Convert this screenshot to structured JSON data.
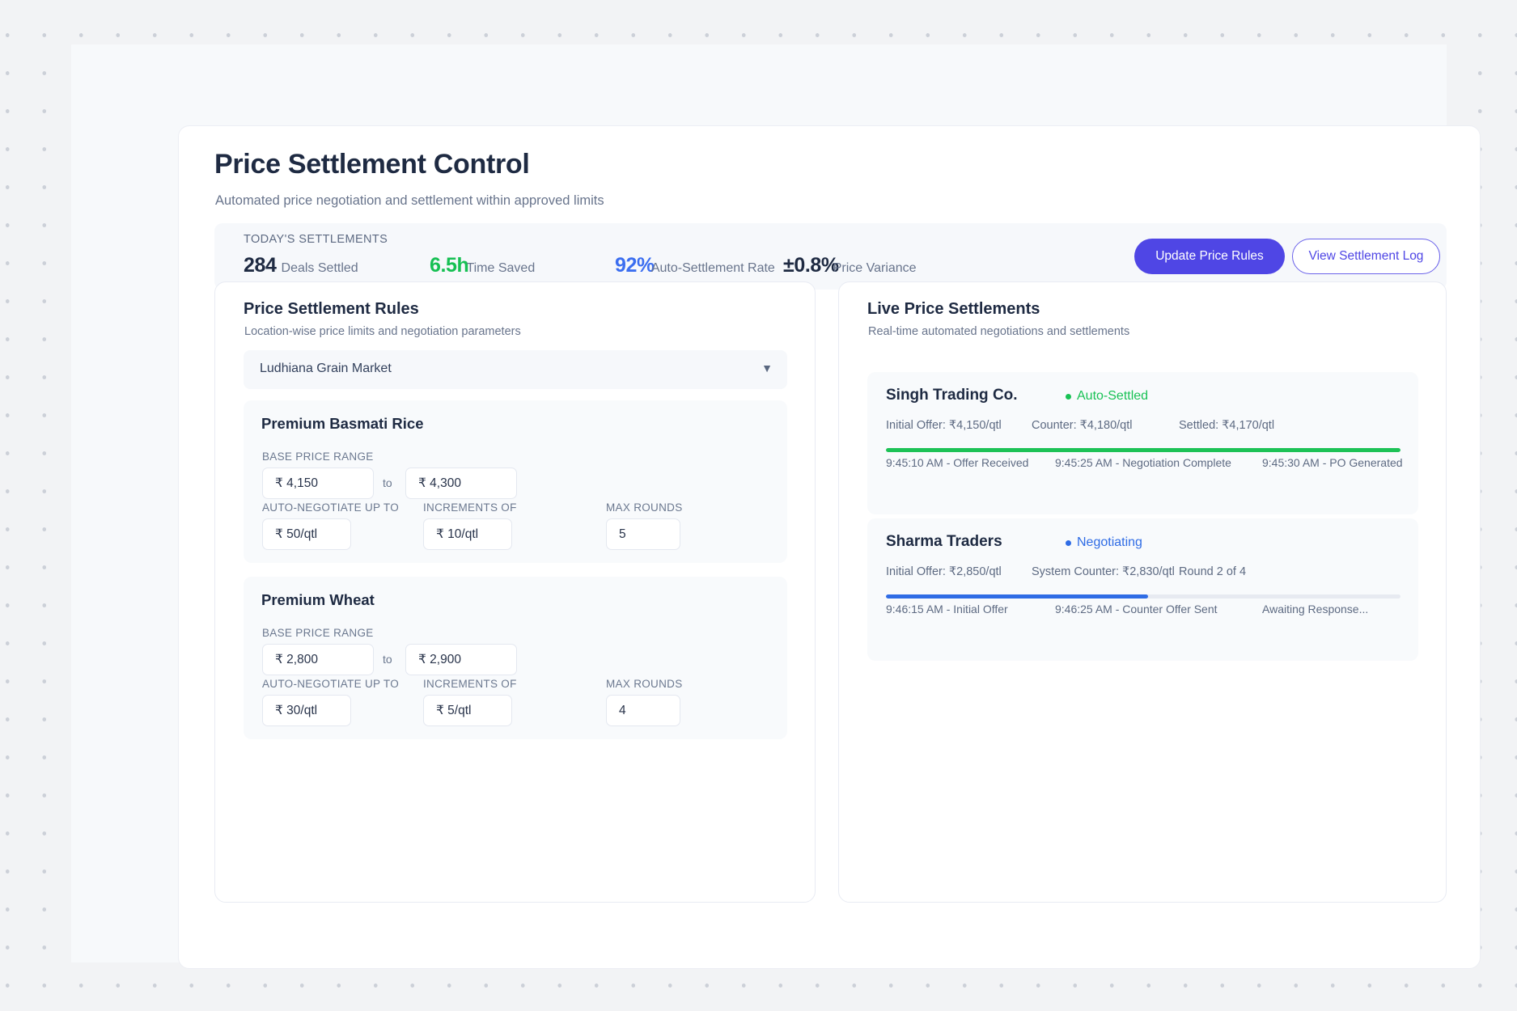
{
  "header": {
    "title": "Price Settlement Control",
    "subtitle": "Automated price negotiation and settlement within approved limits"
  },
  "stats": {
    "eyebrow": "TODAY'S SETTLEMENTS",
    "items": [
      {
        "value": "284",
        "label": "Deals Settled",
        "color": "#1e2a42"
      },
      {
        "value": "6.5h",
        "label": "Time Saved",
        "color": "#16c053"
      },
      {
        "value": "92%",
        "label": "Auto-Settlement Rate",
        "color": "#3b6ef0"
      },
      {
        "value": "±0.8%",
        "label": "Price Variance",
        "color": "#1e2a42"
      }
    ],
    "primary_button": "Update Price Rules",
    "outline_button": "View Settlement Log"
  },
  "rules_panel": {
    "title": "Price Settlement Rules",
    "subtitle": "Location-wise price limits and negotiation parameters",
    "location_select": {
      "value": "Ludhiana Grain Market",
      "caret": "▼"
    },
    "labels": {
      "base_price_range": "BASE PRICE RANGE",
      "auto_negotiate": "AUTO-NEGOTIATE UP TO",
      "increments": "INCREMENTS OF",
      "max_rounds": "MAX ROUNDS",
      "to": "to"
    },
    "commodities": [
      {
        "name": "Premium Basmati Rice",
        "min_price": "₹ 4,150",
        "max_price": "₹ 4,300",
        "auto_negotiate": "₹ 50/qtl",
        "increment": "₹ 10/qtl",
        "max_rounds": "5"
      },
      {
        "name": "Premium Wheat",
        "min_price": "₹ 2,800",
        "max_price": "₹ 2,900",
        "auto_negotiate": "₹ 30/qtl",
        "increment": "₹ 5/qtl",
        "max_rounds": "4"
      }
    ]
  },
  "live_panel": {
    "title": "Live Price Settlements",
    "subtitle": "Real-time automated negotiations and settlements",
    "settlements": [
      {
        "party": "Singh Trading Co.",
        "status": "Auto-Settled",
        "status_color": "#19c255",
        "figure_1": "Initial Offer: ₹4,150/qtl",
        "figure_2": "Counter: ₹4,180/qtl",
        "figure_3": "Settled: ₹4,170/qtl",
        "progress_percent": 100,
        "progress_color": "#1dc256",
        "step_1": "9:45:10 AM - Offer Received",
        "step_2": "9:45:25 AM - Negotiation Complete",
        "step_3": "9:45:30 AM - PO Generated"
      },
      {
        "party": "Sharma Traders",
        "status": "Negotiating",
        "status_color": "#2f6ce5",
        "figure_1": "Initial Offer: ₹2,850/qtl",
        "figure_2": "System Counter: ₹2,830/qtl",
        "figure_3": "Round 2 of 4",
        "progress_percent": 51,
        "progress_color": "#2f6ce5",
        "step_1": "9:46:15 AM - Initial Offer",
        "step_2": "9:46:25 AM - Counter Offer Sent",
        "step_3": "Awaiting Response..."
      }
    ]
  }
}
